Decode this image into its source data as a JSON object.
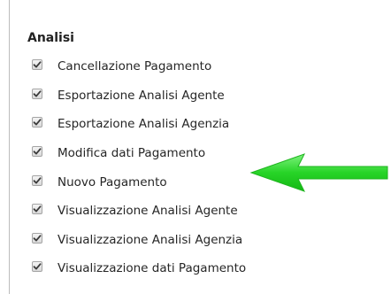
{
  "section": {
    "title": "Analisi"
  },
  "permissions": [
    {
      "label": "Cancellazione Pagamento",
      "checked": true
    },
    {
      "label": "Esportazione Analisi Agente",
      "checked": true
    },
    {
      "label": "Esportazione Analisi Agenzia",
      "checked": true
    },
    {
      "label": "Modifica dati Pagamento",
      "checked": true
    },
    {
      "label": "Nuovo Pagamento",
      "checked": true
    },
    {
      "label": "Visualizzazione Analisi Agente",
      "checked": true
    },
    {
      "label": "Visualizzazione Analisi Agenzia",
      "checked": true
    },
    {
      "label": "Visualizzazione dati Pagamento",
      "checked": true
    }
  ],
  "annotation": {
    "icon": "arrow-left-icon",
    "color": "#2bd62b",
    "points_to_index": 4
  }
}
